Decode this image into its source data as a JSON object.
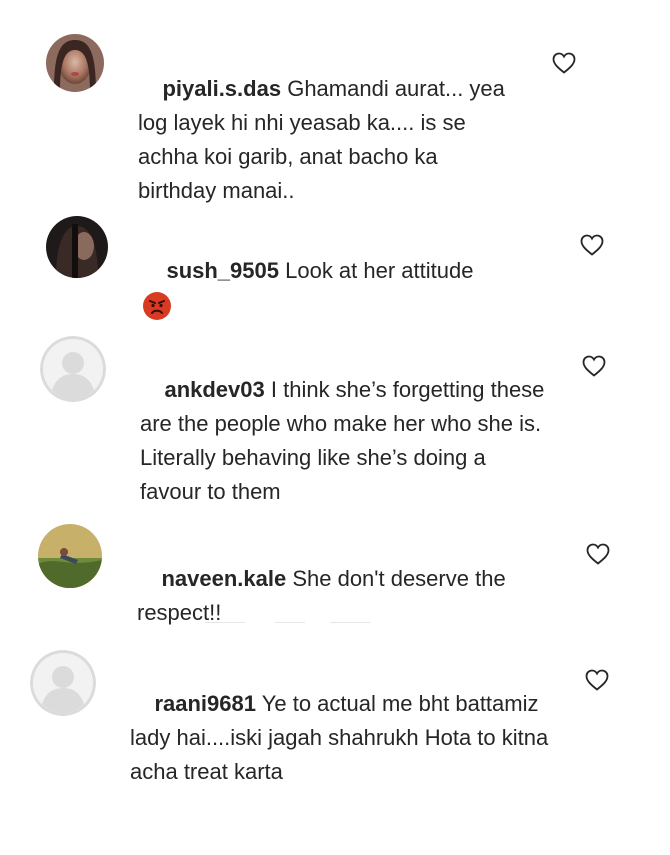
{
  "comments": [
    {
      "username": "piyali.s.das",
      "text": "Ghamandi aurat... yea log layek hi nhi yeasab ka.... is se achha koi garib, anat bacho ka birthday manai..",
      "avatar": "photo-avatar-woman",
      "liked": false
    },
    {
      "username": "sush_9505",
      "text": "Look at her attitude",
      "emoji": "angry-face-emoji",
      "avatar": "photo-avatar-dark",
      "liked": false
    },
    {
      "username": "ankdev03",
      "text": "I think she’s forgetting these are the people who make her who she is. Literally behaving like she’s doing a favour to them",
      "avatar": "default-avatar",
      "liked": false
    },
    {
      "username": "naveen.kale",
      "text": "She don't deserve the respect!!",
      "avatar": "photo-avatar-outdoor",
      "liked": false
    },
    {
      "username": "raani9681",
      "text": "Ye to actual me bht battamiz lady hai....iski jagah shahrukh Hota to kitna acha treat karta",
      "avatar": "default-avatar",
      "liked": false
    }
  ],
  "colors": {
    "text": "#262626",
    "heart_outline": "#262626",
    "default_avatar_bg": "#dbdbdb",
    "angry_emoji": "#d93b22"
  },
  "icons": {
    "like": "heart-outline-icon"
  }
}
